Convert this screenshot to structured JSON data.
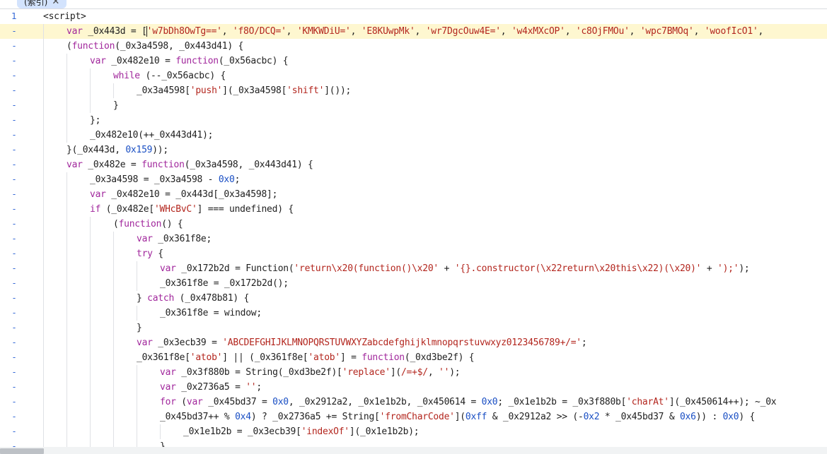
{
  "tab": {
    "label": "(索引)",
    "close_glyph": "✕"
  },
  "gutter": {
    "line1": "1",
    "marker": "-"
  },
  "colors": {
    "keyword": "#a1279c",
    "string": "#b3261e",
    "number": "#1a4fc4",
    "highlight": "#fef7d0",
    "gutter": "#3367d6"
  },
  "lines": [
    {
      "gutter": "1",
      "indent": 0,
      "tokens": [
        [
          "tag",
          "<script>"
        ]
      ]
    },
    {
      "gutter": "-",
      "indent": 1,
      "highlight": true,
      "tokens": [
        [
          "kw",
          "var"
        ],
        [
          "txt",
          " _0x443d = ["
        ],
        [
          "str",
          "'w7bDh8OwTg=='"
        ],
        [
          "txt",
          ", "
        ],
        [
          "str",
          "'f8O/DCQ='"
        ],
        [
          "txt",
          ", "
        ],
        [
          "str",
          "'KMKWDiU='"
        ],
        [
          "txt",
          ", "
        ],
        [
          "str",
          "'E8KUwpMk'"
        ],
        [
          "txt",
          ", "
        ],
        [
          "str",
          "'wr7DgcOuw4E='"
        ],
        [
          "txt",
          ", "
        ],
        [
          "str",
          "'w4xMXcOP'"
        ],
        [
          "txt",
          ", "
        ],
        [
          "str",
          "'c8OjFMOu'"
        ],
        [
          "txt",
          ", "
        ],
        [
          "str",
          "'wpc7BMOq'"
        ],
        [
          "txt",
          ", "
        ],
        [
          "str",
          "'woofIcO1'"
        ],
        [
          "txt",
          ","
        ]
      ]
    },
    {
      "gutter": "-",
      "indent": 1,
      "tokens": [
        [
          "txt",
          "("
        ],
        [
          "kw",
          "function"
        ],
        [
          "txt",
          "(_0x3a4598, _0x443d41) {"
        ]
      ]
    },
    {
      "gutter": "-",
      "indent": 2,
      "tokens": [
        [
          "kw",
          "var"
        ],
        [
          "txt",
          " _0x482e10 = "
        ],
        [
          "kw",
          "function"
        ],
        [
          "txt",
          "(_0x56acbc) {"
        ]
      ]
    },
    {
      "gutter": "-",
      "indent": 3,
      "tokens": [
        [
          "kw",
          "while"
        ],
        [
          "txt",
          " (--_0x56acbc) {"
        ]
      ]
    },
    {
      "gutter": "-",
      "indent": 4,
      "tokens": [
        [
          "txt",
          "_0x3a4598["
        ],
        [
          "str",
          "'push'"
        ],
        [
          "txt",
          "](_0x3a4598["
        ],
        [
          "str",
          "'shift'"
        ],
        [
          "txt",
          "]());"
        ]
      ]
    },
    {
      "gutter": "-",
      "indent": 3,
      "tokens": [
        [
          "txt",
          "}"
        ]
      ]
    },
    {
      "gutter": "-",
      "indent": 2,
      "tokens": [
        [
          "txt",
          "};"
        ]
      ]
    },
    {
      "gutter": "-",
      "indent": 2,
      "tokens": [
        [
          "txt",
          "_0x482e10(++_0x443d41);"
        ]
      ]
    },
    {
      "gutter": "-",
      "indent": 1,
      "tokens": [
        [
          "txt",
          "}(_0x443d, "
        ],
        [
          "num",
          "0x159"
        ],
        [
          "txt",
          "));"
        ]
      ]
    },
    {
      "gutter": "-",
      "indent": 1,
      "tokens": [
        [
          "kw",
          "var"
        ],
        [
          "txt",
          " _0x482e = "
        ],
        [
          "kw",
          "function"
        ],
        [
          "txt",
          "(_0x3a4598, _0x443d41) {"
        ]
      ]
    },
    {
      "gutter": "-",
      "indent": 2,
      "tokens": [
        [
          "txt",
          "_0x3a4598 = _0x3a4598 - "
        ],
        [
          "num",
          "0x0"
        ],
        [
          "txt",
          ";"
        ]
      ]
    },
    {
      "gutter": "-",
      "indent": 2,
      "tokens": [
        [
          "kw",
          "var"
        ],
        [
          "txt",
          " _0x482e10 = _0x443d[_0x3a4598];"
        ]
      ]
    },
    {
      "gutter": "-",
      "indent": 2,
      "tokens": [
        [
          "kw",
          "if"
        ],
        [
          "txt",
          " (_0x482e["
        ],
        [
          "str",
          "'WHcBvC'"
        ],
        [
          "txt",
          "] === undefined) {"
        ]
      ]
    },
    {
      "gutter": "-",
      "indent": 3,
      "tokens": [
        [
          "txt",
          "("
        ],
        [
          "kw",
          "function"
        ],
        [
          "txt",
          "() {"
        ]
      ]
    },
    {
      "gutter": "-",
      "indent": 4,
      "tokens": [
        [
          "kw",
          "var"
        ],
        [
          "txt",
          " _0x361f8e;"
        ]
      ]
    },
    {
      "gutter": "-",
      "indent": 4,
      "tokens": [
        [
          "kw",
          "try"
        ],
        [
          "txt",
          " {"
        ]
      ]
    },
    {
      "gutter": "-",
      "indent": 5,
      "tokens": [
        [
          "kw",
          "var"
        ],
        [
          "txt",
          " _0x172b2d = Function("
        ],
        [
          "str",
          "'return\\x20(function()\\x20'"
        ],
        [
          "txt",
          " + "
        ],
        [
          "str",
          "'{}.constructor(\\x22return\\x20this\\x22)(\\x20)'"
        ],
        [
          "txt",
          " + "
        ],
        [
          "str",
          "');'"
        ],
        [
          "txt",
          ");"
        ]
      ]
    },
    {
      "gutter": "-",
      "indent": 5,
      "tokens": [
        [
          "txt",
          "_0x361f8e = _0x172b2d();"
        ]
      ]
    },
    {
      "gutter": "-",
      "indent": 4,
      "tokens": [
        [
          "txt",
          "} "
        ],
        [
          "kw",
          "catch"
        ],
        [
          "txt",
          " (_0x478b81) {"
        ]
      ]
    },
    {
      "gutter": "-",
      "indent": 5,
      "tokens": [
        [
          "txt",
          "_0x361f8e = window;"
        ]
      ]
    },
    {
      "gutter": "-",
      "indent": 4,
      "tokens": [
        [
          "txt",
          "}"
        ]
      ]
    },
    {
      "gutter": "-",
      "indent": 4,
      "tokens": [
        [
          "kw",
          "var"
        ],
        [
          "txt",
          " _0x3ecb39 = "
        ],
        [
          "str",
          "'ABCDEFGHIJKLMNOPQRSTUVWXYZabcdefghijklmnopqrstuvwxyz0123456789+/='"
        ],
        [
          "txt",
          ";"
        ]
      ]
    },
    {
      "gutter": "-",
      "indent": 4,
      "tokens": [
        [
          "txt",
          "_0x361f8e["
        ],
        [
          "str",
          "'atob'"
        ],
        [
          "txt",
          "] || (_0x361f8e["
        ],
        [
          "str",
          "'atob'"
        ],
        [
          "txt",
          "] = "
        ],
        [
          "kw",
          "function"
        ],
        [
          "txt",
          "(_0xd3be2f) {"
        ]
      ]
    },
    {
      "gutter": "-",
      "indent": 5,
      "tokens": [
        [
          "kw",
          "var"
        ],
        [
          "txt",
          " _0x3f880b = String(_0xd3be2f)["
        ],
        [
          "str",
          "'replace'"
        ],
        [
          "txt",
          "]("
        ],
        [
          "str",
          "/=+$/"
        ],
        [
          "txt",
          ", "
        ],
        [
          "str",
          "''"
        ],
        [
          "txt",
          ");"
        ]
      ]
    },
    {
      "gutter": "-",
      "indent": 5,
      "tokens": [
        [
          "kw",
          "var"
        ],
        [
          "txt",
          " _0x2736a5 = "
        ],
        [
          "str",
          "''"
        ],
        [
          "txt",
          ";"
        ]
      ]
    },
    {
      "gutter": "-",
      "indent": 5,
      "tokens": [
        [
          "kw",
          "for"
        ],
        [
          "txt",
          " ("
        ],
        [
          "kw",
          "var"
        ],
        [
          "txt",
          " _0x45bd37 = "
        ],
        [
          "num",
          "0x0"
        ],
        [
          "txt",
          ", _0x2912a2, _0x1e1b2b, _0x450614 = "
        ],
        [
          "num",
          "0x0"
        ],
        [
          "txt",
          "; _0x1e1b2b = _0x3f880b["
        ],
        [
          "str",
          "'charAt'"
        ],
        [
          "txt",
          "](_0x450614++); ~_0x"
        ]
      ]
    },
    {
      "gutter": "-",
      "indent": 5,
      "tokens": [
        [
          "txt",
          "_0x45bd37++ % "
        ],
        [
          "num",
          "0x4"
        ],
        [
          "txt",
          ") ? _0x2736a5 += String["
        ],
        [
          "str",
          "'fromCharCode'"
        ],
        [
          "txt",
          "]("
        ],
        [
          "num",
          "0xff"
        ],
        [
          "txt",
          " & _0x2912a2 >> (-"
        ],
        [
          "num",
          "0x2"
        ],
        [
          "txt",
          " * _0x45bd37 & "
        ],
        [
          "num",
          "0x6"
        ],
        [
          "txt",
          ")) : "
        ],
        [
          "num",
          "0x0"
        ],
        [
          "txt",
          ") {"
        ]
      ]
    },
    {
      "gutter": "-",
      "indent": 6,
      "tokens": [
        [
          "txt",
          "_0x1e1b2b = _0x3ecb39["
        ],
        [
          "str",
          "'indexOf'"
        ],
        [
          "txt",
          "](_0x1e1b2b);"
        ]
      ]
    },
    {
      "gutter": "-",
      "indent": 5,
      "tokens": [
        [
          "txt",
          "}"
        ]
      ]
    }
  ]
}
